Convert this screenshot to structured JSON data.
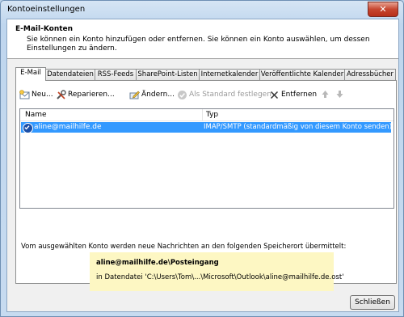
{
  "window": {
    "title": "Kontoeinstellungen",
    "close_glyph": "✕"
  },
  "header": {
    "title": "E-Mail-Konten",
    "description": "Sie können ein Konto hinzufügen oder entfernen. Sie können ein Konto auswählen, um dessen Einstellungen zu ändern."
  },
  "tabs": [
    {
      "label": "E-Mail",
      "active": true
    },
    {
      "label": "Datendateien"
    },
    {
      "label": "RSS-Feeds"
    },
    {
      "label": "SharePoint-Listen"
    },
    {
      "label": "Internetkalender"
    },
    {
      "label": "Veröffentlichte Kalender"
    },
    {
      "label": "Adressbücher"
    }
  ],
  "toolbar": {
    "new_label": "Neu...",
    "repair_label": "Reparieren...",
    "change_label": "Ändern...",
    "default_label": "Als Standard festlegen",
    "remove_label": "Entfernen"
  },
  "grid": {
    "columns": [
      "Name",
      "Typ"
    ],
    "rows": [
      {
        "name": "aline@mailhilfe.de",
        "type": "IMAP/SMTP (standardmäßig von diesem Konto senden)",
        "selected": true
      }
    ]
  },
  "delivery": {
    "label": "Vom ausgewählten Konto werden neue Nachrichten an den folgenden Speicherort übermittelt:",
    "folder": "aline@mailhilfe.de\\Posteingang",
    "file": "in Datendatei 'C:\\Users\\Tom\\...\\Microsoft\\Outlook\\aline@mailhilfe.de.ost'"
  },
  "footer": {
    "close_label": "Schließen"
  },
  "colors": {
    "selection": "#3399ff",
    "highlight_box": "#fdf7c3",
    "title_close": "#c6462f"
  }
}
